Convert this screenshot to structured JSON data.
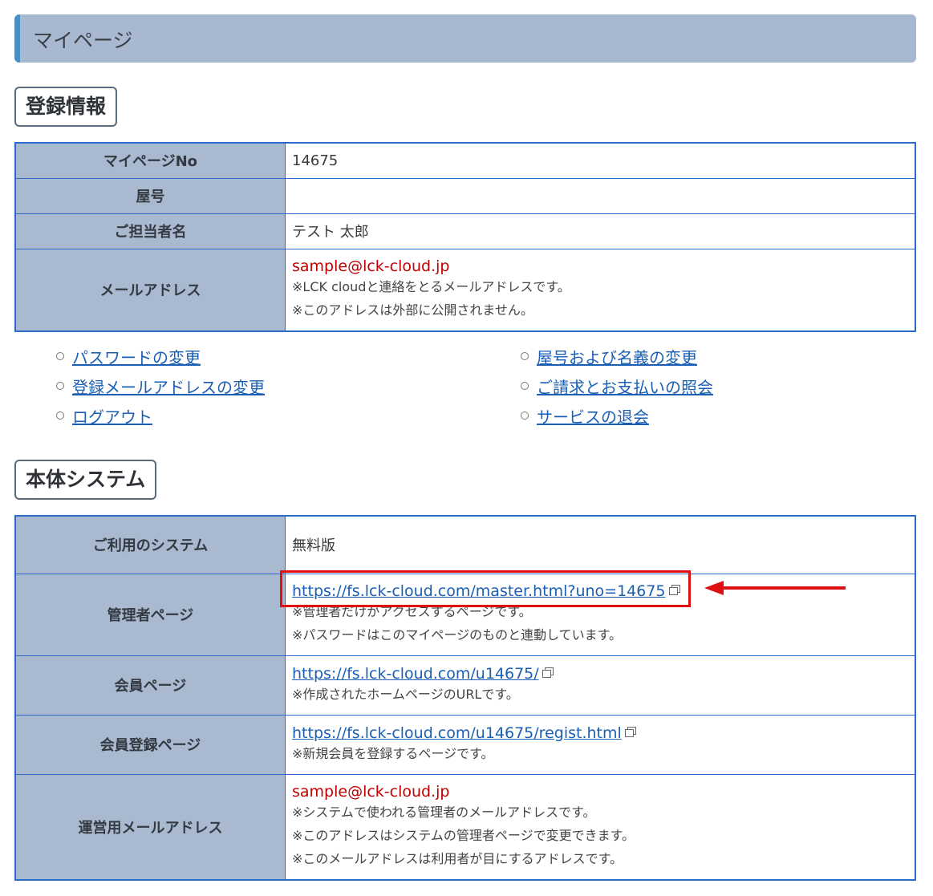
{
  "header": {
    "title": "マイページ"
  },
  "registration": {
    "section_title": "登録情報",
    "rows": [
      {
        "label": "マイページNo",
        "value": "14675"
      },
      {
        "label": "屋号",
        "value": ""
      },
      {
        "label": "ご担当者名",
        "value": "テスト 太郎"
      },
      {
        "label": "メールアドレス",
        "email": "sample@lck-cloud.jp",
        "notes": [
          "※LCK cloudと連絡をとるメールアドレスです。",
          "※このアドレスは外部に公開されません。"
        ]
      }
    ]
  },
  "links": {
    "left": [
      "パスワードの変更",
      "登録メールアドレスの変更",
      "ログアウト"
    ],
    "right": [
      "屋号および名義の変更",
      "ご請求とお支払いの照会",
      "サービスの退会"
    ]
  },
  "system": {
    "section_title": "本体システム",
    "rows": [
      {
        "label": "ご利用のシステム",
        "value": "無料版"
      },
      {
        "label": "管理者ページ",
        "url": "https://fs.lck-cloud.com/master.html?uno=14675",
        "notes": [
          "※管理者だけがアクセスするページです。",
          "※パスワードはこのマイページのものと連動しています。"
        ]
      },
      {
        "label": "会員ページ",
        "url": "https://fs.lck-cloud.com/u14675/",
        "notes": [
          "※作成されたホームページのURLです。"
        ]
      },
      {
        "label": "会員登録ページ",
        "url": "https://fs.lck-cloud.com/u14675/regist.html",
        "notes": [
          "※新規会員を登録するページです。"
        ]
      },
      {
        "label": "運営用メールアドレス",
        "email": "sample@lck-cloud.jp",
        "notes": [
          "※システムで使われる管理者のメールアドレスです。",
          "※このアドレスはシステムの管理者ページで変更できます。",
          "※このメールアドレスは利用者が目にするアドレスです。"
        ]
      }
    ]
  },
  "colors": {
    "header_bg": "#a8b8d0",
    "header_accent": "#4a8ec6",
    "table_border": "#2d6bc8",
    "label_bg": "#a9b9cf",
    "email_red": "#c00000",
    "link_blue": "#1a5fb4",
    "highlight_red": "#e01010"
  },
  "icons": {
    "external_link": "external-link-icon",
    "bullet": "circle-bullet-icon",
    "arrow": "left-arrow-icon"
  }
}
